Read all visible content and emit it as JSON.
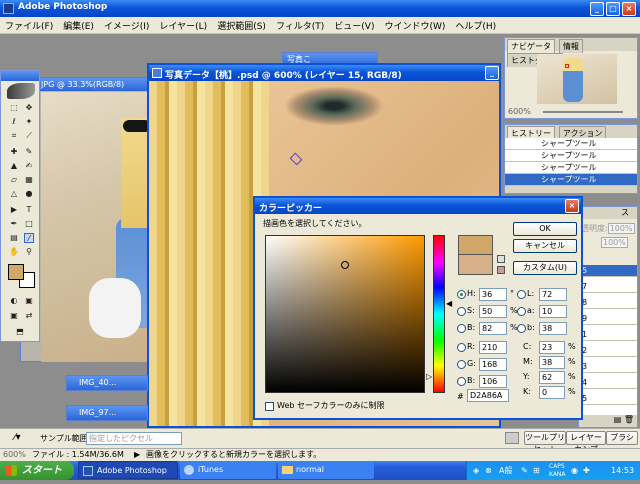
{
  "app": {
    "title": "Adobe Photoshop"
  },
  "menu": [
    "ファイル(F)",
    "編集(E)",
    "イメージ(I)",
    "レイヤー(L)",
    "選択範囲(S)",
    "フィルタ(T)",
    "ビュー(V)",
    "ウインドウ(W)",
    "ヘルプ(H)"
  ],
  "docs": {
    "left_title": "JPG @ 33.3%(RGB/8)",
    "main_title": "写真データ【桃】.psd @ 600% (レイヤー 15, RGB/8)",
    "small_title": "写真こ",
    "min1": "IMG_40...",
    "min2": "IMG_97..."
  },
  "navigator": {
    "tabs": [
      "ナビゲータ",
      "情報",
      "ヒストグラム"
    ],
    "zoom": "600%"
  },
  "history": {
    "tabs": [
      "ヒストリー",
      "アクション"
    ],
    "items": [
      "シャープツール",
      "シャープツール",
      "シャープツール",
      "シャープツール"
    ]
  },
  "layers": {
    "opacity_label": "透明度:",
    "opacity": "100%",
    "fill": "100%",
    "tab_fragment": "ス",
    "numbers": [
      "5",
      "7",
      "8",
      "9",
      "1",
      "2",
      "3",
      "4",
      "5"
    ]
  },
  "picker": {
    "title": "カラーピッカー",
    "prompt": "描画色を選択してください。",
    "ok": "OK",
    "cancel": "キャンセル",
    "custom": "カスタム(U)",
    "H": "36",
    "Hunit": "°",
    "S": "50",
    "Sunit": "%",
    "B": "82",
    "Bunit": "%",
    "R": "210",
    "G": "168",
    "Bv": "106",
    "L": "72",
    "a": "10",
    "b": "38",
    "C": "23",
    "M": "38",
    "Y": "62",
    "K": "0",
    "pct": "%",
    "hex": "D2A86A",
    "hash": "#",
    "websafe": "Web セーフカラーのみに制限",
    "color_new": "#d2a86a",
    "color_old": "#d6b088"
  },
  "options": {
    "sample_label": "サンプル範囲:",
    "sample_value": "指定したピクセル"
  },
  "palette_tabs": [
    "ツールプリセット",
    "レイヤーカンプ",
    "ブラシ"
  ],
  "status": {
    "zoom": "600%",
    "file": "ファイル : 1.54M/36.6M",
    "hint": "画像をクリックすると新規カラーを選択します。"
  },
  "taskbar": {
    "start": "スタート",
    "items": [
      "Adobe Photoshop",
      "iTunes",
      "normal"
    ],
    "tray": [
      "A般",
      "CAPS",
      "KANA"
    ],
    "time": "14:53"
  }
}
